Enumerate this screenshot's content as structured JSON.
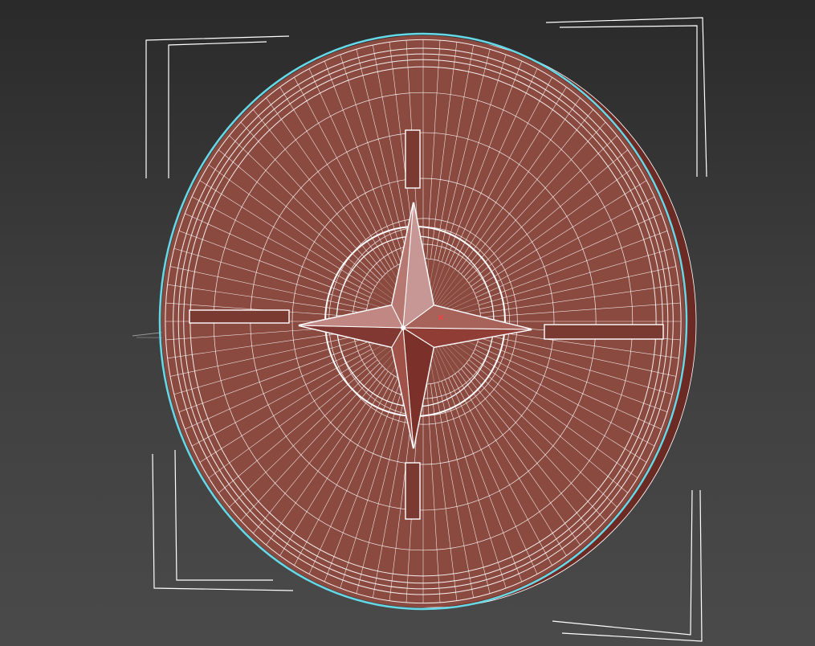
{
  "viewport": {
    "background_top": "#2a2a2a",
    "background_bottom": "#4a4a4a"
  },
  "object": {
    "shape": "disc-with-compass-star",
    "face_color": "#8b4a40",
    "rim_color": "#6b2a24",
    "wire_color": "#ffffff",
    "selection_outline_color": "#66d9e8",
    "radial_segments": 96,
    "concentric_rings": 12
  },
  "selection_bracket": {
    "color": "#ffffff"
  },
  "icons": {
    "star": "compass-star-icon",
    "pivot": "pivot-gizmo-icon"
  }
}
